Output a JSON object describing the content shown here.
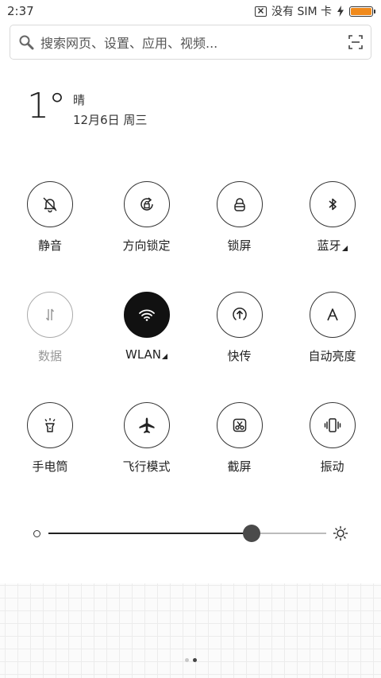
{
  "status_bar": {
    "time": "2:37",
    "carrier": "没有 SIM 卡",
    "battery_color": "#f08a1c"
  },
  "search": {
    "placeholder": "搜索网页、设置、应用、视频..."
  },
  "weather": {
    "temperature": "1°",
    "condition": "晴",
    "date": "12月6日 周三"
  },
  "toggles": [
    [
      {
        "label": "静音",
        "icon": "bell-slash-icon",
        "state": "off"
      },
      {
        "label": "方向锁定",
        "icon": "rotation-lock-icon",
        "state": "off"
      },
      {
        "label": "锁屏",
        "icon": "lock-icon",
        "state": "off"
      },
      {
        "label": "蓝牙",
        "icon": "bluetooth-icon",
        "state": "off",
        "has_more": true
      }
    ],
    [
      {
        "label": "数据",
        "icon": "data-arrows-icon",
        "state": "disabled"
      },
      {
        "label": "WLAN",
        "icon": "wifi-icon",
        "state": "on",
        "has_more": true
      },
      {
        "label": "快传",
        "icon": "upload-circle-icon",
        "state": "off"
      },
      {
        "label": "自动亮度",
        "icon": "auto-brightness-icon",
        "state": "off"
      }
    ],
    [
      {
        "label": "手电筒",
        "icon": "flashlight-icon",
        "state": "off"
      },
      {
        "label": "飞行模式",
        "icon": "airplane-icon",
        "state": "off"
      },
      {
        "label": "截屏",
        "icon": "screenshot-icon",
        "state": "off"
      },
      {
        "label": "振动",
        "icon": "vibrate-icon",
        "state": "off"
      }
    ]
  ],
  "brightness": {
    "level": 0.73
  },
  "pager": {
    "pages": 2,
    "current": 2
  }
}
